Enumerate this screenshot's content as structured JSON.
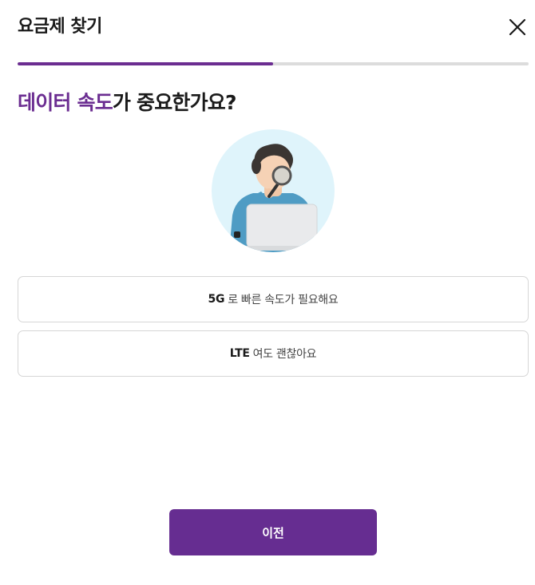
{
  "header": {
    "title": "요금제 찾기",
    "close_icon": "close-icon"
  },
  "progress": {
    "fraction": 0.5,
    "fill_color": "#6b2d91"
  },
  "question": {
    "highlight": "데이터 속도",
    "rest": "가 중요한가요?",
    "highlight_color": "#6b2d91"
  },
  "illustration": {
    "icon": "person-with-magnifier-and-laptop-illustration"
  },
  "options": [
    {
      "strong": "5G",
      "text": "로 빠른 속도가 필요해요"
    },
    {
      "strong": "LTE",
      "text": "여도 괜찮아요"
    }
  ],
  "footer": {
    "prev_label": "이전",
    "button_color": "#662d91"
  }
}
